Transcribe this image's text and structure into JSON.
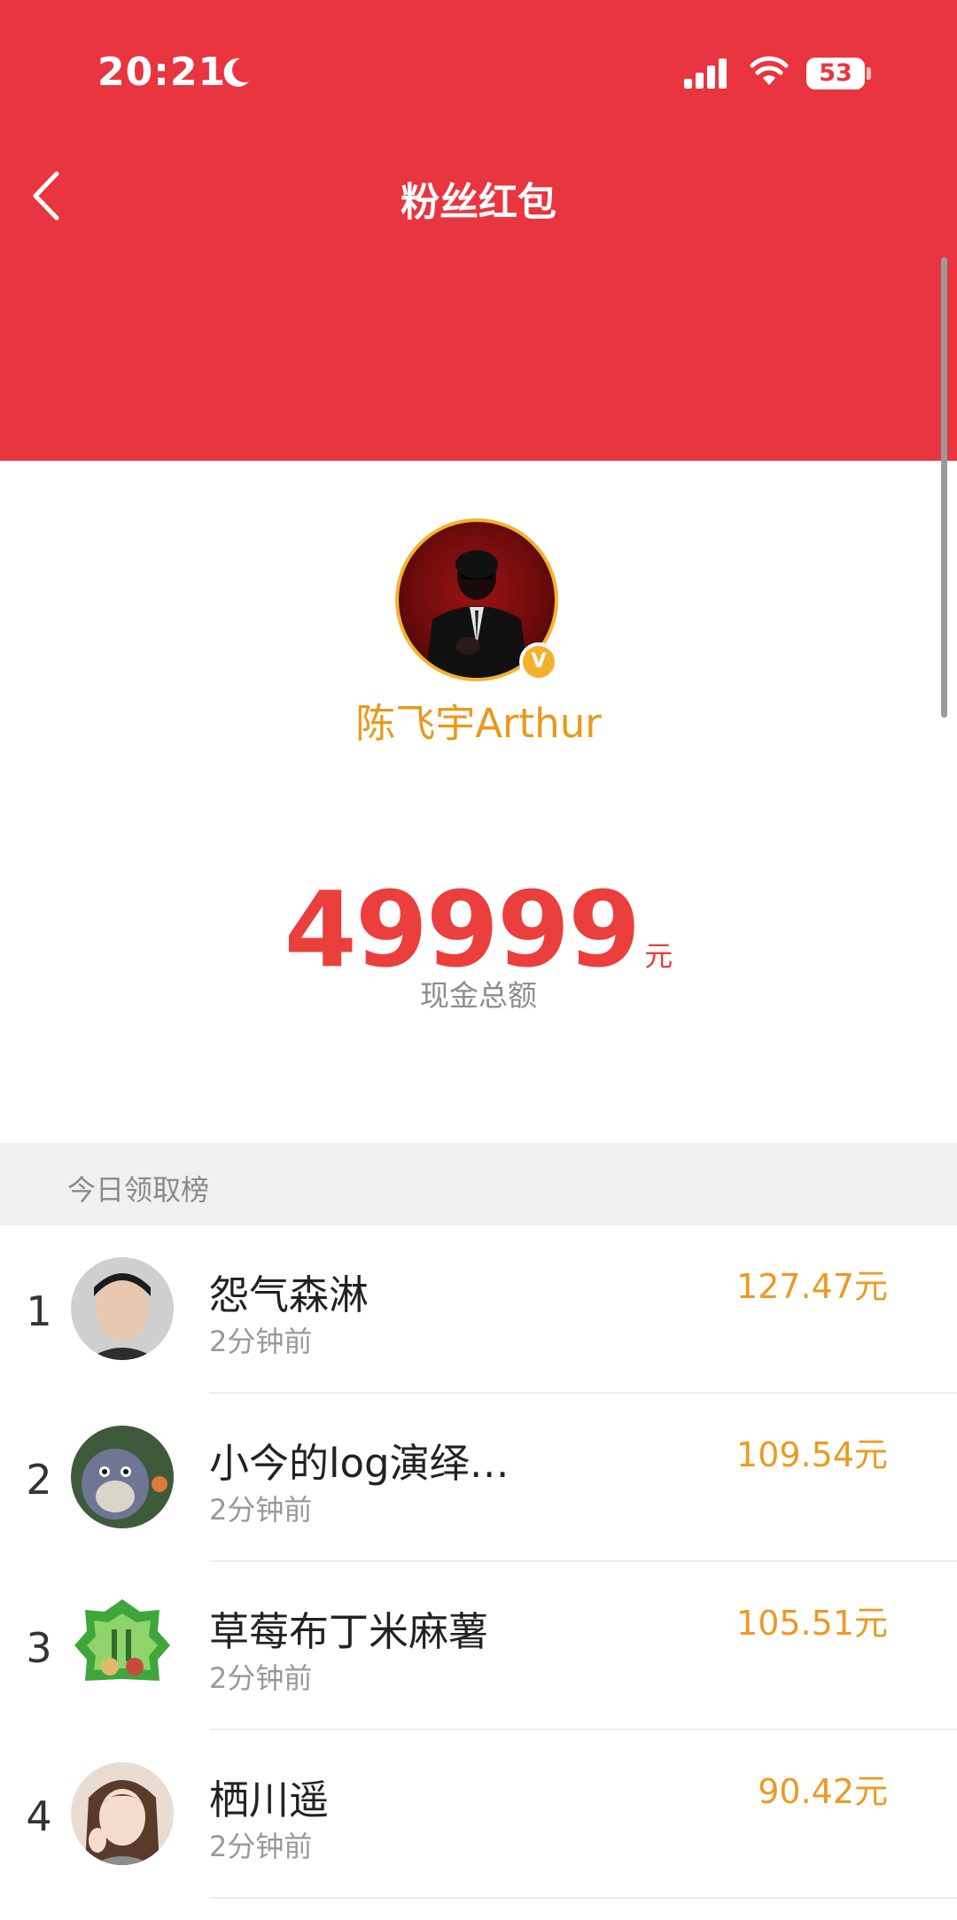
{
  "status_bar": {
    "time": "20:21",
    "battery": "53",
    "icons": [
      "moon-icon",
      "signal-icon",
      "wifi-icon",
      "battery-icon"
    ]
  },
  "nav": {
    "title": "粉丝红包",
    "back_icon": "chevron-left-icon"
  },
  "profile": {
    "name": "陈飞宇Arthur",
    "verified_mark": "V"
  },
  "amount": {
    "value": "49999",
    "unit": "元",
    "caption": "现金总额"
  },
  "section": {
    "title": "今日领取榜"
  },
  "leaderboard": [
    {
      "rank": "1",
      "name": "怨气森淋",
      "time": "2分钟前",
      "amount": "127.47元"
    },
    {
      "rank": "2",
      "name": "小今的log演绎…",
      "time": "2分钟前",
      "amount": "109.54元"
    },
    {
      "rank": "3",
      "name": "草莓布丁米麻薯",
      "time": "2分钟前",
      "amount": "105.51元"
    },
    {
      "rank": "4",
      "name": "栖川遥",
      "time": "2分钟前",
      "amount": "90.42元"
    }
  ],
  "colors": {
    "header_red": "#e8353f",
    "amount_red": "#ea3f3c",
    "name_gold": "#e99a1b",
    "list_amount_orange": "#ec9a22"
  }
}
